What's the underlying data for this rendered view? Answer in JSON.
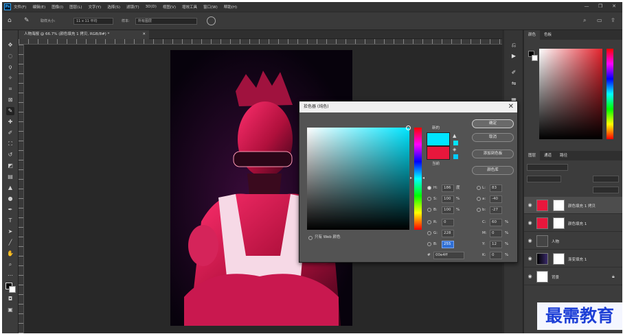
{
  "menubar": {
    "logo": "Ps",
    "items": [
      "文件(F)",
      "编辑(E)",
      "图像(I)",
      "图层(L)",
      "文字(Y)",
      "选择(S)",
      "滤镜(T)",
      "3D(D)",
      "视图(V)",
      "增效工具",
      "窗口(W)",
      "帮助(H)"
    ],
    "window_buttons": [
      "—",
      "❐",
      "✕"
    ]
  },
  "options": {
    "sample_label": "取样大小:",
    "sample_value": "11 x 11 平均",
    "sample_from_label": "样本:",
    "sample_from_value": "所有图层"
  },
  "document": {
    "tab_title": "人物海报 @ 66.7% (颜色填充 1 拷贝, RGB/8#) *",
    "tab_close": "✕"
  },
  "color_panel": {
    "tabs": [
      "颜色",
      "色板"
    ],
    "panel_color": "#e4232d"
  },
  "layers_panel": {
    "tabs": [
      "图层",
      "通道",
      "路径"
    ],
    "layers": [
      {
        "name": "颜色填充 1 拷贝",
        "thumb_color": "#e8173c"
      },
      {
        "name": "颜色填充 1",
        "thumb_color": "#e8173c"
      },
      {
        "name": "人物",
        "thumb_color": "#444444"
      },
      {
        "name": "渐变填充 1",
        "thumb_color": "#1b1b3a"
      },
      {
        "name": "背景",
        "thumb_color": "#ffffff"
      }
    ]
  },
  "color_picker": {
    "title": "拾色器 (纯色)",
    "close": "✕",
    "new_label": "新的",
    "current_label": "当前",
    "new_color": "#00e5ff",
    "current_color": "#e8173c",
    "buttons": {
      "ok": "确定",
      "cancel": "取消",
      "add_swatch": "添加到色板",
      "libraries": "颜色库"
    },
    "web_only_label": "只有 Web 颜色",
    "hsb": {
      "H": "186",
      "S": "100",
      "B": "100",
      "H_unit": "度",
      "S_unit": "%",
      "B_unit": "%"
    },
    "rgb": {
      "R": "0",
      "G": "228",
      "B": "255"
    },
    "lab": {
      "L": "83",
      "a": "-40",
      "b": "-27"
    },
    "cmyk": {
      "C": "60",
      "M": "0",
      "Y": "12",
      "K": "0",
      "unit": "%"
    },
    "hex_label": "#",
    "hex": "00e4ff"
  },
  "watermark": {
    "text": "最需教育"
  }
}
